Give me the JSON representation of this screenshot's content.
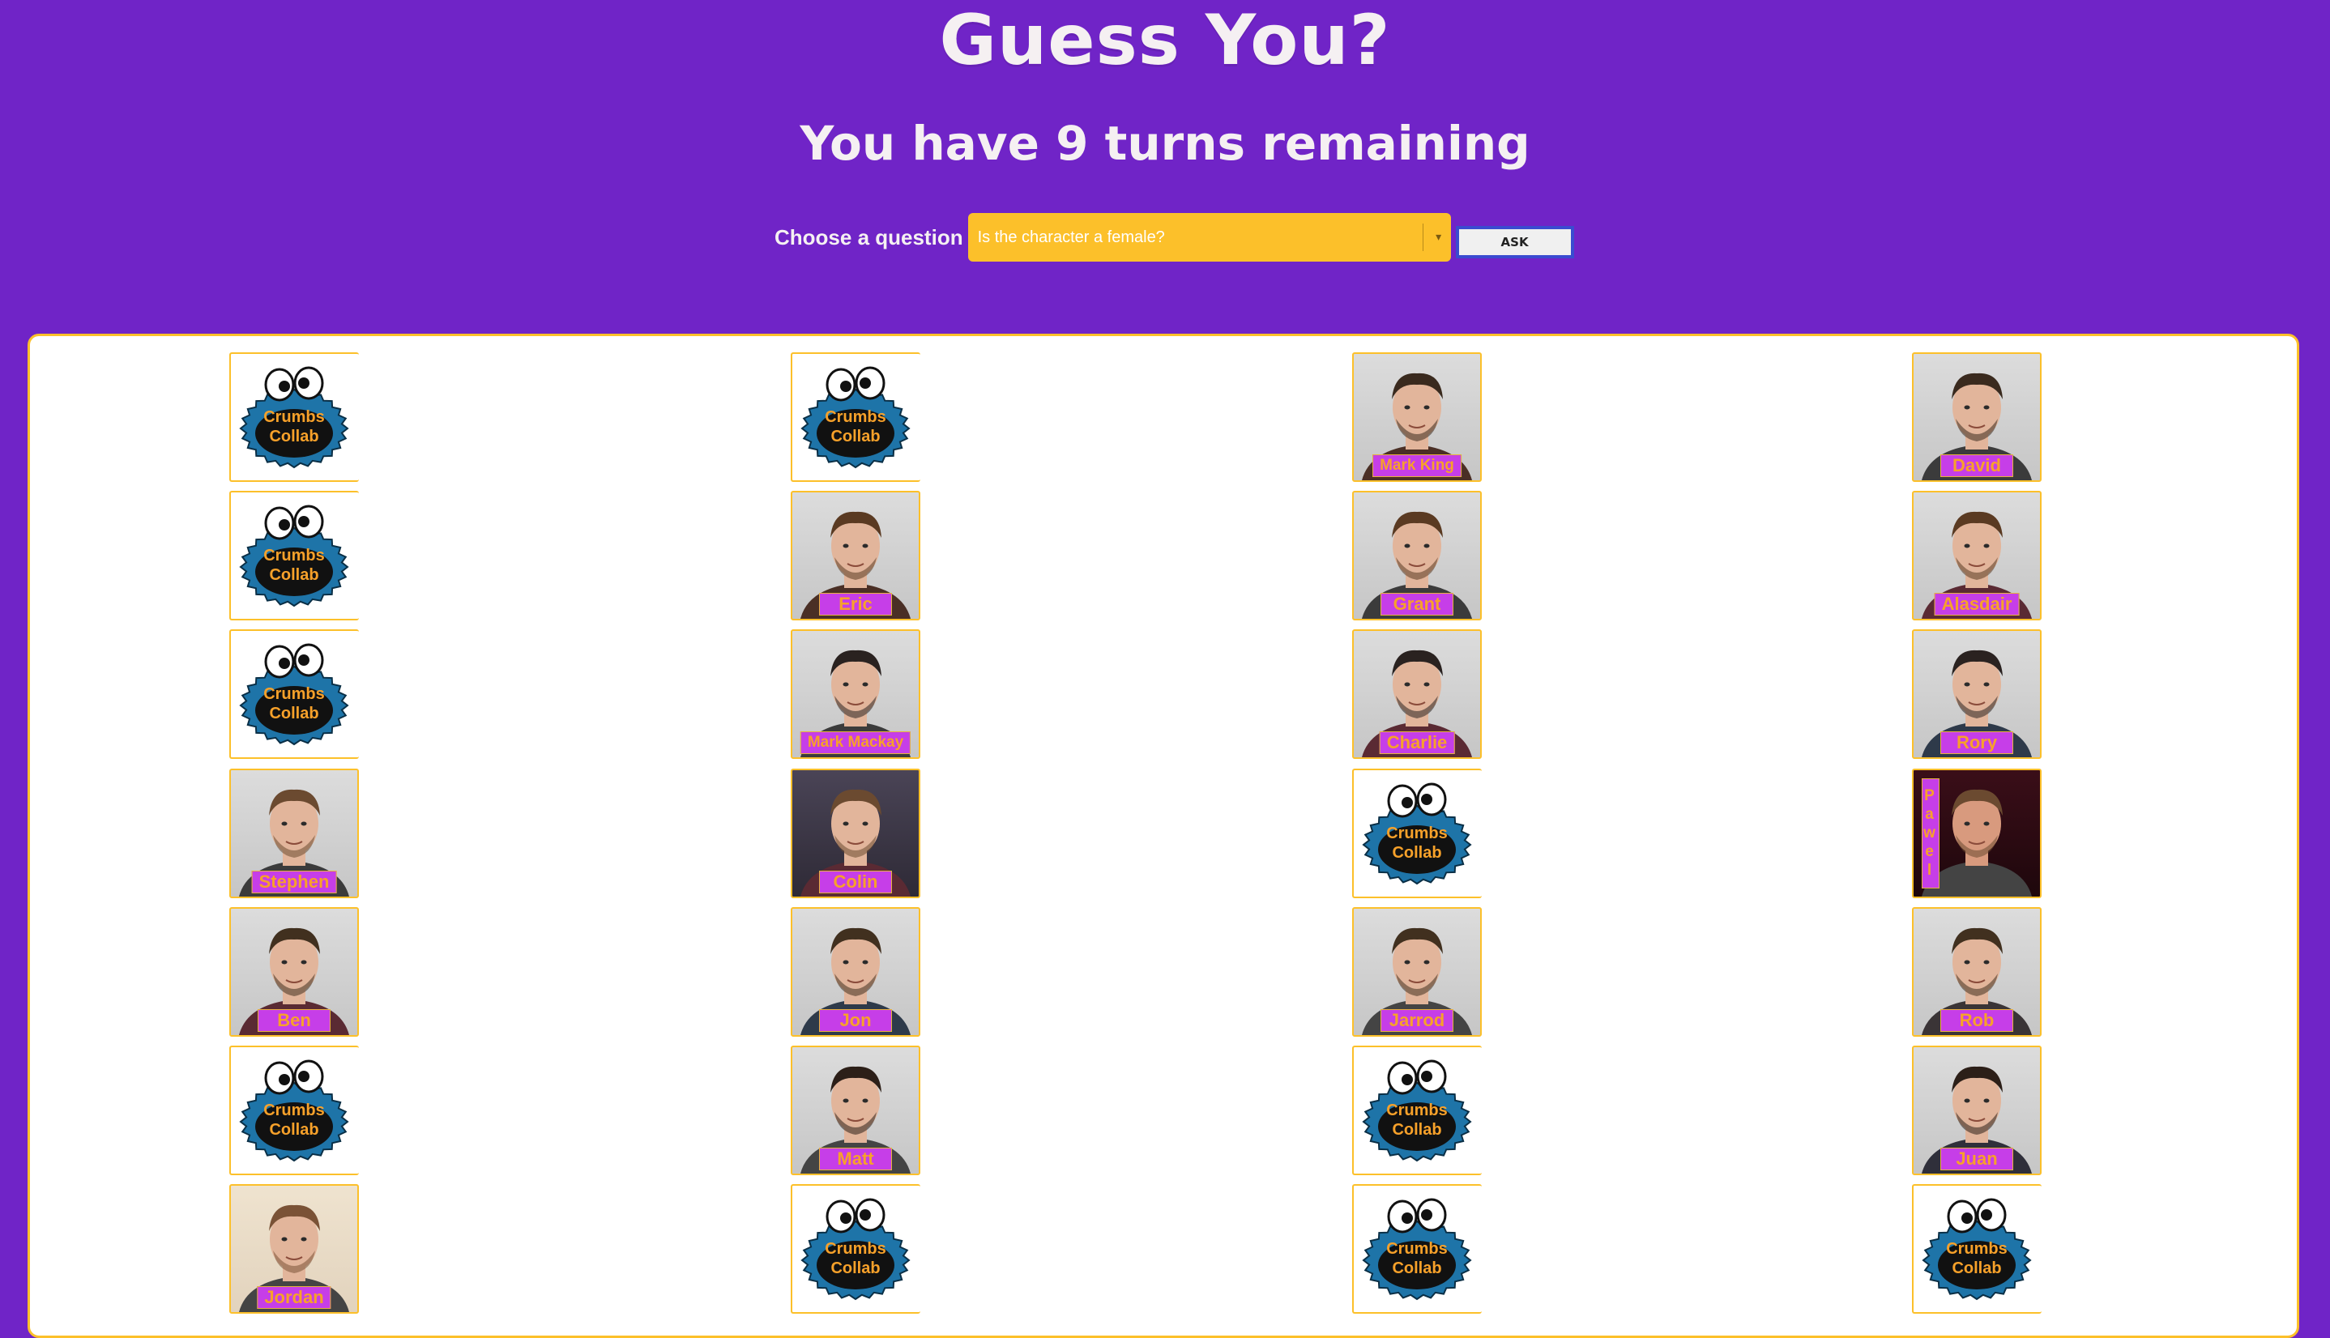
{
  "header": {
    "title": "Guess You?",
    "turns_text": "You have 9 turns remaining"
  },
  "question": {
    "label": "Choose a question",
    "selected": "Is the character a female?",
    "ask_label": "ASK"
  },
  "colors": {
    "background": "#7024c7",
    "accent": "#fcc02a",
    "name_tag": "#c63ee8",
    "name_text": "#f7a12a",
    "cookie_blue": "#1e74a8"
  },
  "hidden_label": [
    "Crumbs",
    "Collab"
  ],
  "board": {
    "columns": [
      [
        {
          "name": "",
          "hidden": true
        },
        {
          "name": "",
          "hidden": true
        },
        {
          "name": "",
          "hidden": true
        },
        {
          "name": "Stephen",
          "hidden": false
        },
        {
          "name": "Ben",
          "hidden": false
        },
        {
          "name": "",
          "hidden": true
        },
        {
          "name": "Jordan",
          "hidden": false
        }
      ],
      [
        {
          "name": "",
          "hidden": true
        },
        {
          "name": "Eric",
          "hidden": false
        },
        {
          "name": "Mark Mackay",
          "hidden": false
        },
        {
          "name": "Colin",
          "hidden": false
        },
        {
          "name": "Jon",
          "hidden": false
        },
        {
          "name": "Matt",
          "hidden": false
        },
        {
          "name": "",
          "hidden": true
        }
      ],
      [
        {
          "name": "Mark King",
          "hidden": false
        },
        {
          "name": "Grant",
          "hidden": false
        },
        {
          "name": "Charlie",
          "hidden": false
        },
        {
          "name": "",
          "hidden": true
        },
        {
          "name": "Jarrod",
          "hidden": false
        },
        {
          "name": "",
          "hidden": true
        },
        {
          "name": "",
          "hidden": true
        }
      ],
      [
        {
          "name": "David",
          "hidden": false
        },
        {
          "name": "Alasdair",
          "hidden": false
        },
        {
          "name": "Rory",
          "hidden": false
        },
        {
          "name": "Pawel",
          "hidden": false
        },
        {
          "name": "Rob",
          "hidden": false
        },
        {
          "name": "Juan",
          "hidden": false
        },
        {
          "name": "",
          "hidden": true
        }
      ]
    ]
  }
}
